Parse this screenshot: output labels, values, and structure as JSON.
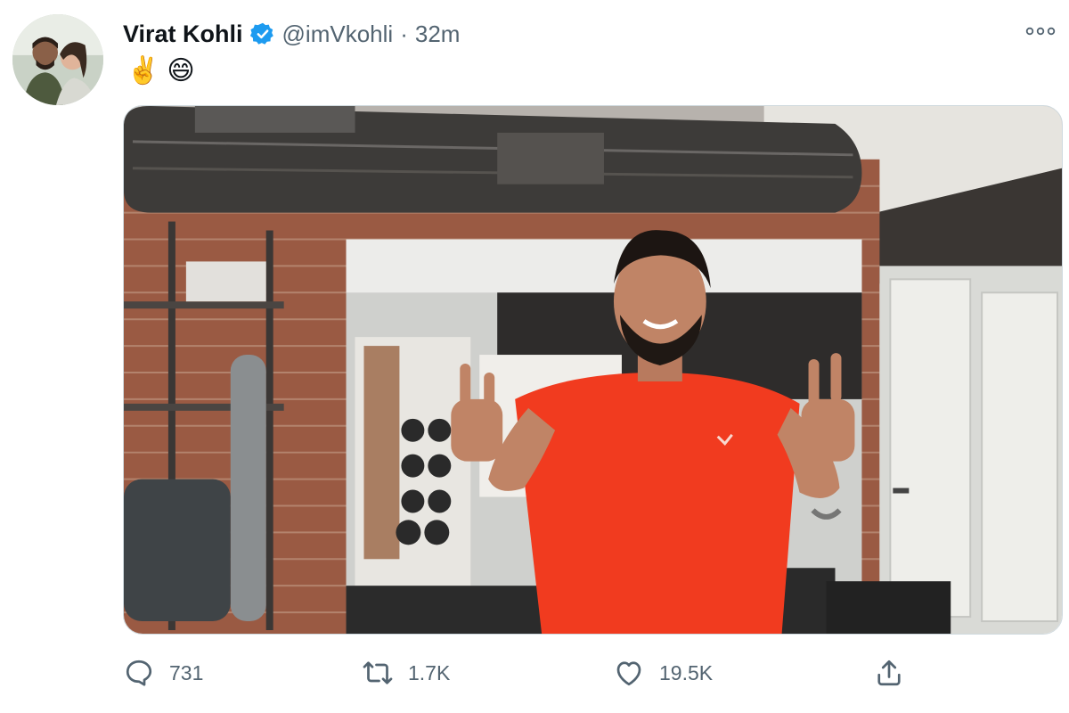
{
  "tweet": {
    "author_name": "Virat Kohli",
    "handle": "@imVkohli",
    "separator": "·",
    "time": "32m",
    "text_emojis": [
      "✌️",
      "😄"
    ],
    "icons": {
      "verified": "verified-badge-icon",
      "more": "more-options-icon",
      "reply": "reply-icon",
      "retweet": "retweet-icon",
      "like": "like-icon",
      "share": "share-icon"
    },
    "colors": {
      "verified_blue": "#1d9bf0",
      "secondary_text": "#536471",
      "primary_text": "#0f1419"
    }
  },
  "actions": {
    "reply_count": "731",
    "retweet_count": "1.7K",
    "like_count": "19.5K"
  }
}
